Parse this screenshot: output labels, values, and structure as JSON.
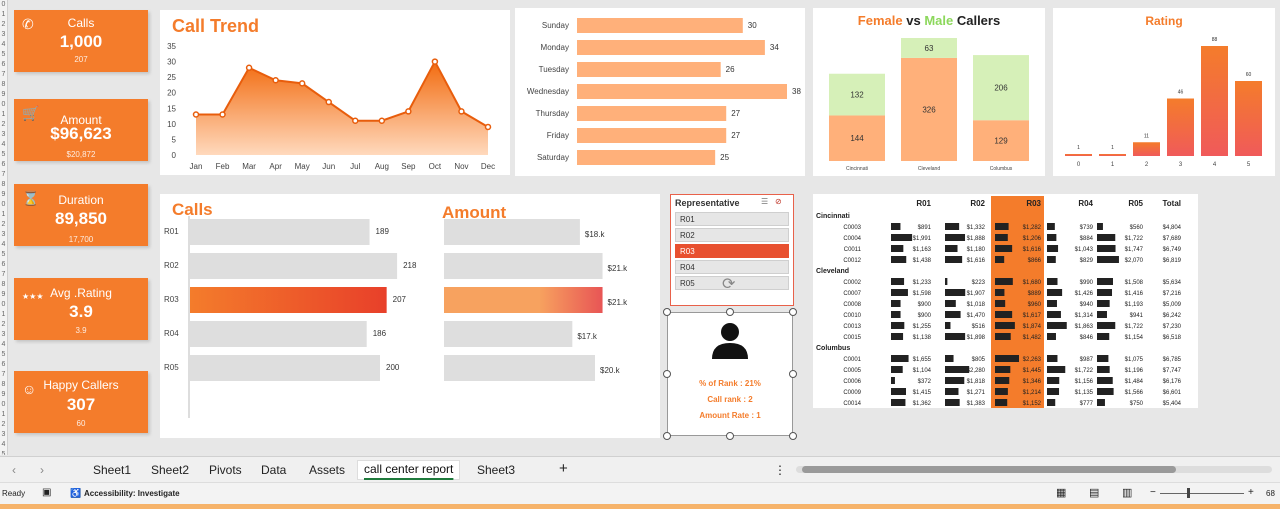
{
  "kpis": [
    {
      "title": "Calls",
      "value": "1,000",
      "sub": "207",
      "icon": "phone-icon"
    },
    {
      "title": "Amount",
      "value": "$96,623",
      "sub": "$20,872",
      "icon": "cart-icon"
    },
    {
      "title": "Duration",
      "value": "89,850",
      "sub": "17,700",
      "icon": "hourglass-icon"
    },
    {
      "title": "Avg .Rating",
      "value": "3.9",
      "sub": "3.9",
      "icon": "stars-icon"
    },
    {
      "title": "Happy Callers",
      "value": "307",
      "sub": "60",
      "icon": "smiley-icon"
    }
  ],
  "call_trend": {
    "title": "Call Trend"
  },
  "calls_chart": {
    "title": "Calls"
  },
  "amount_chart": {
    "title": "Amount"
  },
  "gender_chart": {
    "t1": "Female",
    "t2": "vs",
    "t3": "Male",
    "t4": "Callers"
  },
  "rating_chart": {
    "title": "Rating"
  },
  "chart_data": [
    {
      "type": "area",
      "title": "Call Trend",
      "categories": [
        "Jan",
        "Feb",
        "Mar",
        "Apr",
        "May",
        "Jun",
        "Jul",
        "Aug",
        "Sep",
        "Oct",
        "Nov",
        "Dec"
      ],
      "values": [
        13,
        13,
        28,
        24,
        23,
        17,
        11,
        11,
        14,
        30,
        14,
        9
      ],
      "ylim": [
        0,
        35
      ],
      "yticks": [
        0,
        5,
        10,
        15,
        20,
        25,
        30,
        35
      ]
    },
    {
      "type": "bar",
      "orientation": "horizontal",
      "categories": [
        "Sunday",
        "Monday",
        "Tuesday",
        "Wednesday",
        "Thursday",
        "Friday",
        "Saturday"
      ],
      "values": [
        30,
        34,
        26,
        38,
        27,
        27,
        25
      ]
    },
    {
      "type": "bar",
      "stacked": true,
      "title": "Female vs Male Callers",
      "categories": [
        "Cincinnati",
        "Cleveland",
        "Columbus"
      ],
      "series": [
        {
          "name": "Female",
          "values": [
            144,
            326,
            129
          ]
        },
        {
          "name": "Male",
          "values": [
            132,
            63,
            206
          ]
        }
      ]
    },
    {
      "type": "bar",
      "title": "Rating",
      "categories": [
        "0",
        "1",
        "2",
        "3",
        "4",
        "5"
      ],
      "values": [
        1,
        1,
        11,
        46,
        88,
        60
      ]
    },
    {
      "type": "bar",
      "orientation": "horizontal",
      "title": "Calls",
      "categories": [
        "R01",
        "R02",
        "R03",
        "R04",
        "R05"
      ],
      "values": [
        189,
        218,
        207,
        186,
        200
      ]
    },
    {
      "type": "bar",
      "orientation": "horizontal",
      "title": "Amount",
      "categories": [
        "R01",
        "R02",
        "R03",
        "R04",
        "R05"
      ],
      "values": [
        18,
        21,
        21,
        17,
        20
      ],
      "labels": [
        "$18.k",
        "$21.k",
        "$21.k",
        "$17.k",
        "$20.k"
      ]
    }
  ],
  "slicer": {
    "header": "Representative",
    "items": [
      "R01",
      "R02",
      "R03",
      "R04",
      "R05"
    ],
    "selected": "R03"
  },
  "rep_card": {
    "line1": "% of Rank : 21%",
    "line2": "Call rank : 2",
    "line3": "Amount Rate : 1"
  },
  "pivot": {
    "headers": [
      "R01",
      "R02",
      "R03",
      "R04",
      "R05",
      "Total"
    ],
    "groups": [
      {
        "name": "Cincinnati",
        "rows": [
          {
            "id": "C0003",
            "vals": [
              "$891",
              "$1,332",
              "$1,282",
              "$739",
              "$560",
              "$4,804"
            ]
          },
          {
            "id": "C0004",
            "vals": [
              "$1,991",
              "$1,888",
              "$1,206",
              "$884",
              "$1,722",
              "$7,689"
            ]
          },
          {
            "id": "C0011",
            "vals": [
              "$1,163",
              "$1,180",
              "$1,616",
              "$1,043",
              "$1,747",
              "$6,749"
            ]
          },
          {
            "id": "C0012",
            "vals": [
              "$1,438",
              "$1,616",
              "$866",
              "$829",
              "$2,070",
              "$6,819"
            ]
          }
        ]
      },
      {
        "name": "Cleveland",
        "rows": [
          {
            "id": "C0002",
            "vals": [
              "$1,233",
              "$223",
              "$1,680",
              "$990",
              "$1,508",
              "$5,634"
            ]
          },
          {
            "id": "C0007",
            "vals": [
              "$1,598",
              "$1,907",
              "$889",
              "$1,426",
              "$1,416",
              "$7,216"
            ]
          },
          {
            "id": "C0008",
            "vals": [
              "$900",
              "$1,018",
              "$960",
              "$940",
              "$1,193",
              "$5,009"
            ]
          },
          {
            "id": "C0010",
            "vals": [
              "$900",
              "$1,470",
              "$1,617",
              "$1,314",
              "$941",
              "$6,242"
            ]
          },
          {
            "id": "C0013",
            "vals": [
              "$1,255",
              "$516",
              "$1,874",
              "$1,863",
              "$1,722",
              "$7,230"
            ]
          },
          {
            "id": "C0015",
            "vals": [
              "$1,138",
              "$1,898",
              "$1,482",
              "$846",
              "$1,154",
              "$6,518"
            ]
          }
        ]
      },
      {
        "name": "Columbus",
        "rows": [
          {
            "id": "C0001",
            "vals": [
              "$1,655",
              "$805",
              "$2,263",
              "$987",
              "$1,075",
              "$6,785"
            ]
          },
          {
            "id": "C0005",
            "vals": [
              "$1,104",
              "$2,280",
              "$1,445",
              "$1,722",
              "$1,196",
              "$7,747"
            ]
          },
          {
            "id": "C0006",
            "vals": [
              "$372",
              "$1,818",
              "$1,346",
              "$1,156",
              "$1,484",
              "$6,176"
            ]
          },
          {
            "id": "C0009",
            "vals": [
              "$1,415",
              "$1,271",
              "$1,214",
              "$1,135",
              "$1,566",
              "$6,601"
            ]
          },
          {
            "id": "C0014",
            "vals": [
              "$1,362",
              "$1,383",
              "$1,152",
              "$777",
              "$750",
              "$5,404"
            ]
          }
        ]
      }
    ]
  },
  "sheet_tabs": [
    "Sheet1",
    "Sheet2",
    "Pivots",
    "Data",
    "Assets",
    "call center report",
    "Sheet3"
  ],
  "active_tab": "call center report",
  "status": {
    "ready": "Ready",
    "accessibility": "Accessibility: Investigate",
    "zoom": "68"
  },
  "colors": {
    "accent": "#f47c2b",
    "bar_light": "#ffb07a",
    "female": "#ffb07a",
    "male": "#d6f0b8",
    "selected": "#e8502f"
  }
}
